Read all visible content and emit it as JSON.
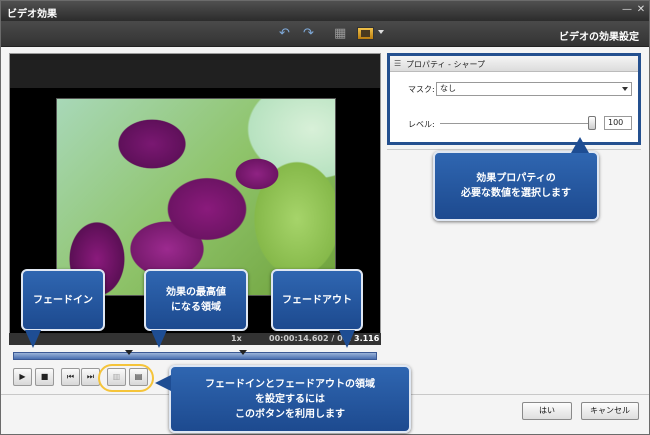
{
  "window": {
    "title": "ビデオ効果"
  },
  "titlebar_icons": {
    "minimize": "minimize-icon",
    "close": "close-icon"
  },
  "toolbar": {
    "undo_icon": "undo-icon",
    "redo_icon": "redo-icon",
    "grid_icon": "grid-icon",
    "monitor_icon": "monitor-icon",
    "panel_title": "ビデオの効果設定"
  },
  "preview": {
    "speed": "1x",
    "current_time": "00:00:14.602",
    "separator": "/",
    "total_time_visible": "00:",
    "total_time_tail": "3.116"
  },
  "controls": {
    "play": "play-icon",
    "stop": "stop-icon",
    "prev": "previous-frame-icon",
    "next": "next-frame-icon",
    "fade_in_button": "fade-in-region-icon",
    "fade_out_button": "fade-out-region-icon"
  },
  "properties": {
    "header": "プロパティ - シャープ",
    "mask_label": "マスク:",
    "mask_value": "なし",
    "level_label": "レベル:",
    "level_value": "100",
    "level_fraction": 1.0
  },
  "callouts": {
    "properties_hint": "効果プロパティの\n必要な数値を選択します",
    "fade_in": "フェードイン",
    "peak": "効果の最高値\nになる領域",
    "fade_out": "フェードアウト",
    "buttons_hint": "フェードインとフェードアウトの領域\nを設定するには\nこのボタンを利用します"
  },
  "buttons": {
    "ok": "はい",
    "cancel": "キャンセル"
  },
  "colors": {
    "callout": "#2a5ea8",
    "highlight": "#f5c43a",
    "panel_border": "#24508f"
  }
}
